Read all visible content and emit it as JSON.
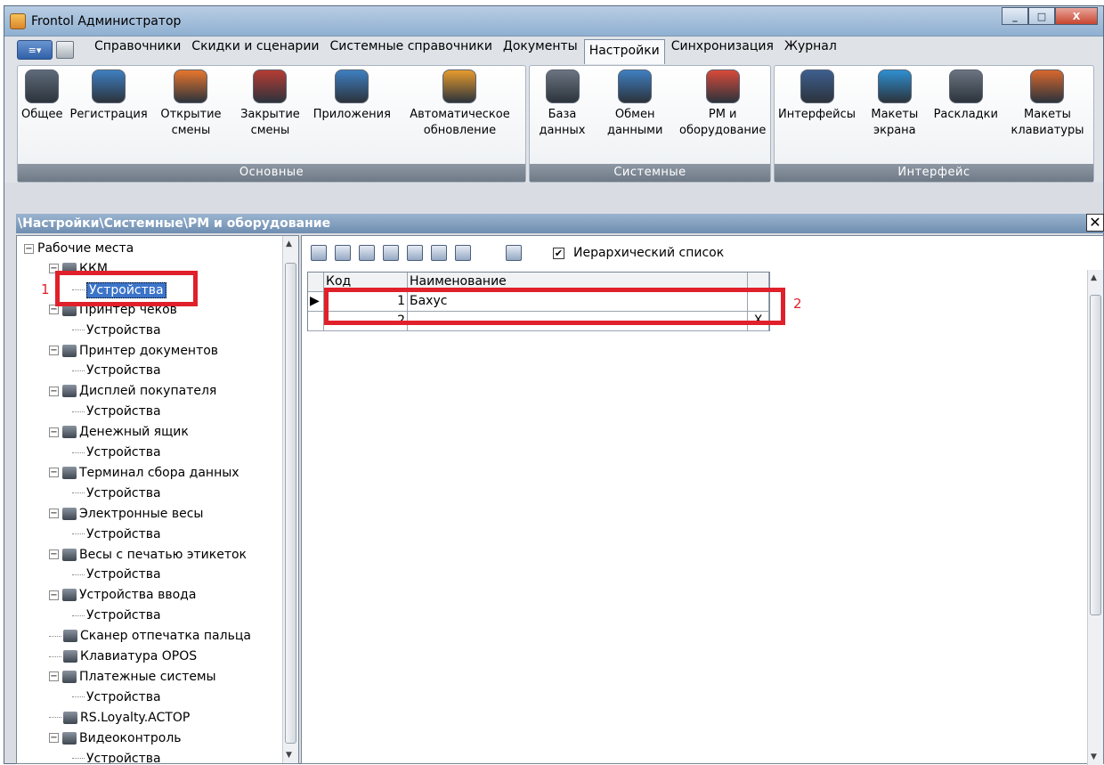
{
  "window": {
    "title": "Frontol Администратор",
    "buttons": [
      "_",
      "□",
      "X"
    ]
  },
  "menu": {
    "tabs": [
      "Справочники",
      "Скидки и сценарии",
      "Системные справочники",
      "Документы",
      "Настройки",
      "Синхронизация",
      "Журнал"
    ],
    "active": "Настройки"
  },
  "ribbon": {
    "groups": [
      {
        "label": "Основные",
        "items": [
          {
            "label": "Общее",
            "icon": "general-settings-icon",
            "color": "#5f6b7a"
          },
          {
            "label": "Регистрация",
            "icon": "registration-icon",
            "color": "#3e7fc1"
          },
          {
            "label": "Открытие смены",
            "icon": "open-shift-icon",
            "color": "#e8762d"
          },
          {
            "label": "Закрытие смены",
            "icon": "close-shift-icon",
            "color": "#b73b34"
          },
          {
            "label": "Приложения",
            "icon": "applications-icon",
            "color": "#3e7fc1"
          },
          {
            "label": "Автоматическое обновление",
            "icon": "auto-update-icon",
            "color": "#e89b2d"
          }
        ]
      },
      {
        "label": "Системные",
        "items": [
          {
            "label": "База данных",
            "icon": "database-icon",
            "color": "#6b7480"
          },
          {
            "label": "Обмен данными",
            "icon": "data-exchange-icon",
            "color": "#3e7fc1"
          },
          {
            "label": "РМ и оборудование",
            "icon": "workplace-equipment-icon",
            "color": "#d94a3a"
          }
        ]
      },
      {
        "label": "Интерфейс",
        "items": [
          {
            "label": "Интерфейсы",
            "icon": "interfaces-icon",
            "color": "#3e5f8f"
          },
          {
            "label": "Макеты экрана",
            "icon": "screen-layouts-icon",
            "color": "#2e8fd1"
          },
          {
            "label": "Раскладки",
            "icon": "keyboard-layouts-icon",
            "color": "#6b7480"
          },
          {
            "label": "Макеты клавиатуры",
            "icon": "keyboard-templates-icon",
            "color": "#d9682d"
          }
        ]
      }
    ]
  },
  "path": "\\Настройки\\Системные\\РМ и оборудование",
  "tree": [
    {
      "label": "Рабочие места",
      "level": 0,
      "expander": "−"
    },
    {
      "label": "ККМ",
      "level": 1,
      "expander": "−",
      "icon": "kkm-icon"
    },
    {
      "label": "Устройства",
      "level": 2,
      "selected": true
    },
    {
      "label": "Принтер чеков",
      "level": 1,
      "expander": "−",
      "icon": "receipt-printer-icon"
    },
    {
      "label": "Устройства",
      "level": 2
    },
    {
      "label": "Принтер документов",
      "level": 1,
      "expander": "−",
      "icon": "document-printer-icon"
    },
    {
      "label": "Устройства",
      "level": 2
    },
    {
      "label": "Дисплей покупателя",
      "level": 1,
      "expander": "−",
      "icon": "customer-display-icon"
    },
    {
      "label": "Устройства",
      "level": 2
    },
    {
      "label": "Денежный ящик",
      "level": 1,
      "expander": "−",
      "icon": "cash-drawer-icon"
    },
    {
      "label": "Устройства",
      "level": 2
    },
    {
      "label": "Терминал сбора данных",
      "level": 1,
      "expander": "−",
      "icon": "data-terminal-icon"
    },
    {
      "label": "Устройства",
      "level": 2
    },
    {
      "label": "Электронные весы",
      "level": 1,
      "expander": "−",
      "icon": "scales-icon"
    },
    {
      "label": "Устройства",
      "level": 2
    },
    {
      "label": "Весы с печатью этикеток",
      "level": 1,
      "expander": "−",
      "icon": "label-scales-icon"
    },
    {
      "label": "Устройства",
      "level": 2
    },
    {
      "label": "Устройства ввода",
      "level": 1,
      "expander": "−",
      "icon": "input-devices-icon"
    },
    {
      "label": "Устройства",
      "level": 2
    },
    {
      "label": "Сканер отпечатка пальца",
      "level": 1,
      "icon": "fingerprint-scanner-icon"
    },
    {
      "label": "Клавиатура OPOS",
      "level": 1,
      "icon": "opos-keyboard-icon"
    },
    {
      "label": "Платежные системы",
      "level": 1,
      "expander": "−",
      "icon": "payment-systems-icon"
    },
    {
      "label": "Устройства",
      "level": 2
    },
    {
      "label": "RS.Loyalty.ACTOP",
      "level": 1,
      "icon": "loyalty-icon"
    },
    {
      "label": "Видеоконтроль",
      "level": 1,
      "expander": "−",
      "icon": "video-control-icon"
    },
    {
      "label": "Устройства",
      "level": 2
    }
  ],
  "toolbar": {
    "checkbox_label": "Иерархический список",
    "checkbox_checked": "✔"
  },
  "grid": {
    "headers": [
      "Код",
      "Наименование"
    ],
    "rows": [
      {
        "indicator": "▶",
        "code": "1",
        "name": "Бахус",
        "action": ""
      },
      {
        "indicator": "",
        "code": "2",
        "name": "",
        "action": "X"
      }
    ]
  },
  "annotations": [
    "1",
    "2"
  ]
}
